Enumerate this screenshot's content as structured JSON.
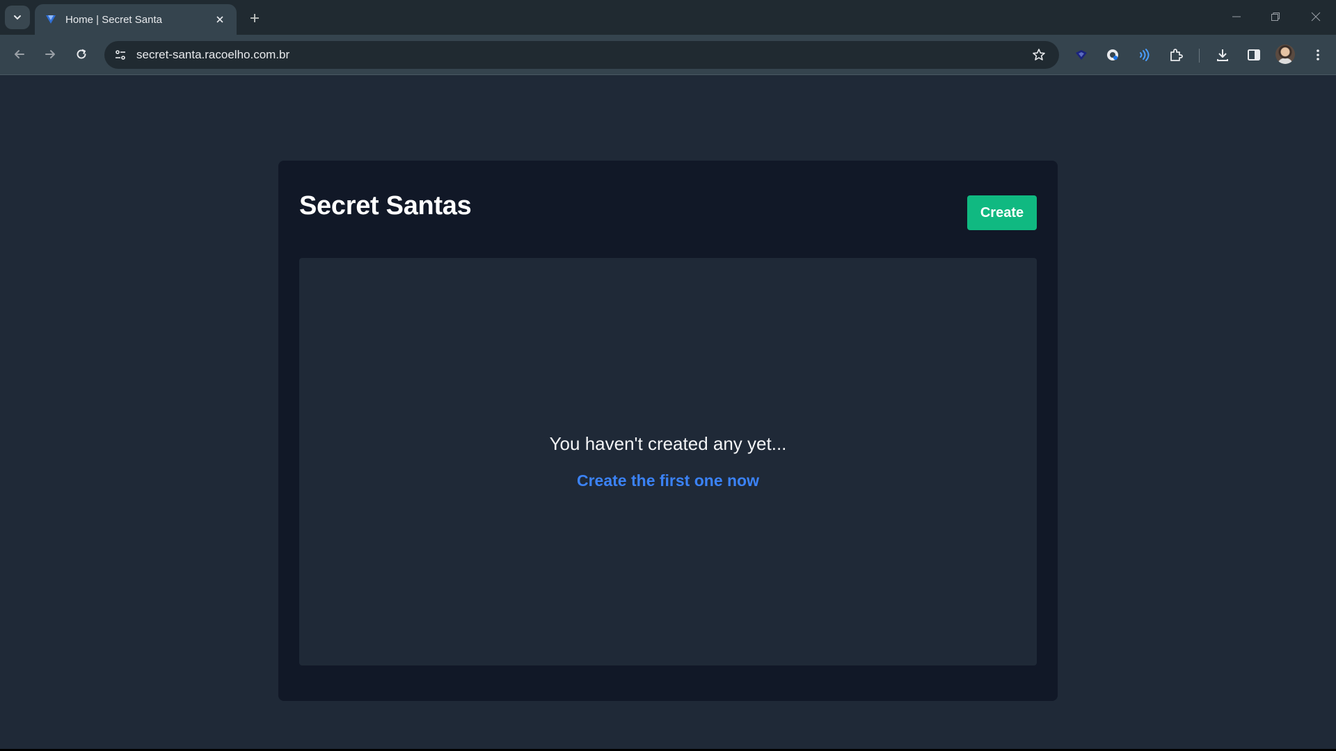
{
  "browser": {
    "tab": {
      "title": "Home | Secret Santa",
      "favicon": "secret-santa-favicon"
    },
    "address_bar": {
      "url": "secret-santa.racoelho.com.br"
    },
    "extensions": [
      "vpn-extension-icon",
      "password-manager-icon",
      "audio-extension-icon",
      "puzzle-icon"
    ],
    "colors": {
      "tabbar": "#202a31",
      "toolbar": "#35444e",
      "omnibox": "#202a31"
    }
  },
  "header": {
    "title": "Secret Santas",
    "create_label": "Create"
  },
  "empty_state": {
    "message": "You haven't created any yet...",
    "link_label": "Create the first one now"
  },
  "colors": {
    "page_bg": "#1f2937",
    "card_bg": "#111827",
    "create_button": "#10b981",
    "link": "#3b82f6"
  }
}
